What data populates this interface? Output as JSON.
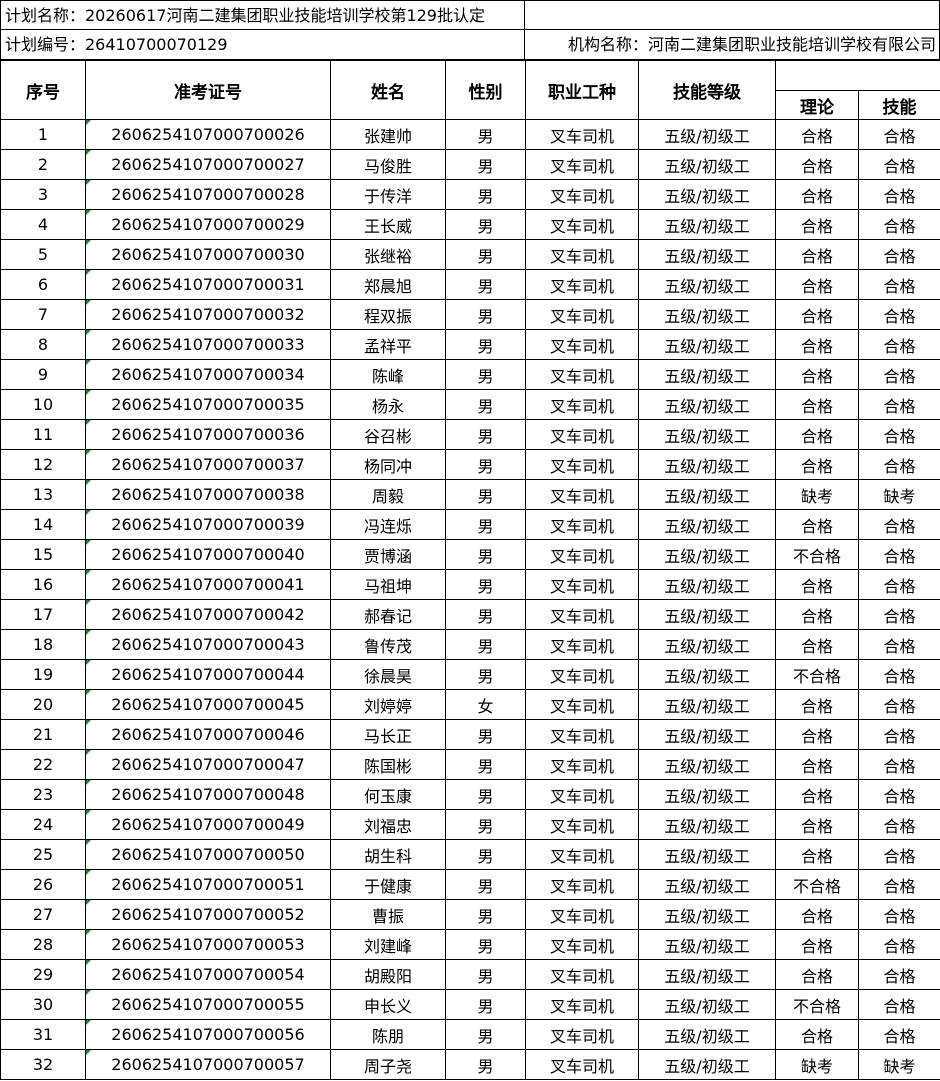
{
  "header": {
    "plan_name": "计划名称：20260617河南二建集团职业技能培训学校第129批认定",
    "plan_number": "计划编号：26410700070129",
    "org_name": "机构名称：河南二建集团职业技能培训学校有限公司"
  },
  "columns": {
    "seq": "序号",
    "ticket": "准考证号",
    "name": "姓名",
    "gender": "性别",
    "job": "职业工种",
    "level": "技能等级",
    "theory": "理论",
    "skill": "技能"
  },
  "rows": [
    {
      "seq": "1",
      "ticket": "2606254107000700026",
      "name": "张建帅",
      "gender": "男",
      "job": "叉车司机",
      "level": "五级/初级工",
      "theory": "合格",
      "skill": "合格"
    },
    {
      "seq": "2",
      "ticket": "2606254107000700027",
      "name": "马俊胜",
      "gender": "男",
      "job": "叉车司机",
      "level": "五级/初级工",
      "theory": "合格",
      "skill": "合格"
    },
    {
      "seq": "3",
      "ticket": "2606254107000700028",
      "name": "于传洋",
      "gender": "男",
      "job": "叉车司机",
      "level": "五级/初级工",
      "theory": "合格",
      "skill": "合格"
    },
    {
      "seq": "4",
      "ticket": "2606254107000700029",
      "name": "王长威",
      "gender": "男",
      "job": "叉车司机",
      "level": "五级/初级工",
      "theory": "合格",
      "skill": "合格"
    },
    {
      "seq": "5",
      "ticket": "2606254107000700030",
      "name": "张继裕",
      "gender": "男",
      "job": "叉车司机",
      "level": "五级/初级工",
      "theory": "合格",
      "skill": "合格"
    },
    {
      "seq": "6",
      "ticket": "2606254107000700031",
      "name": "郑晨旭",
      "gender": "男",
      "job": "叉车司机",
      "level": "五级/初级工",
      "theory": "合格",
      "skill": "合格"
    },
    {
      "seq": "7",
      "ticket": "2606254107000700032",
      "name": "程双振",
      "gender": "男",
      "job": "叉车司机",
      "level": "五级/初级工",
      "theory": "合格",
      "skill": "合格"
    },
    {
      "seq": "8",
      "ticket": "2606254107000700033",
      "name": "孟祥平",
      "gender": "男",
      "job": "叉车司机",
      "level": "五级/初级工",
      "theory": "合格",
      "skill": "合格"
    },
    {
      "seq": "9",
      "ticket": "2606254107000700034",
      "name": "陈峰",
      "gender": "男",
      "job": "叉车司机",
      "level": "五级/初级工",
      "theory": "合格",
      "skill": "合格"
    },
    {
      "seq": "10",
      "ticket": "2606254107000700035",
      "name": "杨永",
      "gender": "男",
      "job": "叉车司机",
      "level": "五级/初级工",
      "theory": "合格",
      "skill": "合格"
    },
    {
      "seq": "11",
      "ticket": "2606254107000700036",
      "name": "谷召彬",
      "gender": "男",
      "job": "叉车司机",
      "level": "五级/初级工",
      "theory": "合格",
      "skill": "合格"
    },
    {
      "seq": "12",
      "ticket": "2606254107000700037",
      "name": "杨同冲",
      "gender": "男",
      "job": "叉车司机",
      "level": "五级/初级工",
      "theory": "合格",
      "skill": "合格"
    },
    {
      "seq": "13",
      "ticket": "2606254107000700038",
      "name": "周毅",
      "gender": "男",
      "job": "叉车司机",
      "level": "五级/初级工",
      "theory": "缺考",
      "skill": "缺考"
    },
    {
      "seq": "14",
      "ticket": "2606254107000700039",
      "name": "冯连烁",
      "gender": "男",
      "job": "叉车司机",
      "level": "五级/初级工",
      "theory": "合格",
      "skill": "合格"
    },
    {
      "seq": "15",
      "ticket": "2606254107000700040",
      "name": "贾博涵",
      "gender": "男",
      "job": "叉车司机",
      "level": "五级/初级工",
      "theory": "不合格",
      "skill": "合格"
    },
    {
      "seq": "16",
      "ticket": "2606254107000700041",
      "name": "马祖坤",
      "gender": "男",
      "job": "叉车司机",
      "level": "五级/初级工",
      "theory": "合格",
      "skill": "合格"
    },
    {
      "seq": "17",
      "ticket": "2606254107000700042",
      "name": "郝春记",
      "gender": "男",
      "job": "叉车司机",
      "level": "五级/初级工",
      "theory": "合格",
      "skill": "合格"
    },
    {
      "seq": "18",
      "ticket": "2606254107000700043",
      "name": "鲁传茂",
      "gender": "男",
      "job": "叉车司机",
      "level": "五级/初级工",
      "theory": "合格",
      "skill": "合格"
    },
    {
      "seq": "19",
      "ticket": "2606254107000700044",
      "name": "徐晨昊",
      "gender": "男",
      "job": "叉车司机",
      "level": "五级/初级工",
      "theory": "不合格",
      "skill": "合格"
    },
    {
      "seq": "20",
      "ticket": "2606254107000700045",
      "name": "刘婷婷",
      "gender": "女",
      "job": "叉车司机",
      "level": "五级/初级工",
      "theory": "合格",
      "skill": "合格"
    },
    {
      "seq": "21",
      "ticket": "2606254107000700046",
      "name": "马长正",
      "gender": "男",
      "job": "叉车司机",
      "level": "五级/初级工",
      "theory": "合格",
      "skill": "合格"
    },
    {
      "seq": "22",
      "ticket": "2606254107000700047",
      "name": "陈国彬",
      "gender": "男",
      "job": "叉车司机",
      "level": "五级/初级工",
      "theory": "合格",
      "skill": "合格"
    },
    {
      "seq": "23",
      "ticket": "2606254107000700048",
      "name": "何玉康",
      "gender": "男",
      "job": "叉车司机",
      "level": "五级/初级工",
      "theory": "合格",
      "skill": "合格"
    },
    {
      "seq": "24",
      "ticket": "2606254107000700049",
      "name": "刘福忠",
      "gender": "男",
      "job": "叉车司机",
      "level": "五级/初级工",
      "theory": "合格",
      "skill": "合格"
    },
    {
      "seq": "25",
      "ticket": "2606254107000700050",
      "name": "胡生科",
      "gender": "男",
      "job": "叉车司机",
      "level": "五级/初级工",
      "theory": "合格",
      "skill": "合格"
    },
    {
      "seq": "26",
      "ticket": "2606254107000700051",
      "name": "于健康",
      "gender": "男",
      "job": "叉车司机",
      "level": "五级/初级工",
      "theory": "不合格",
      "skill": "合格"
    },
    {
      "seq": "27",
      "ticket": "2606254107000700052",
      "name": "曹振",
      "gender": "男",
      "job": "叉车司机",
      "level": "五级/初级工",
      "theory": "合格",
      "skill": "合格"
    },
    {
      "seq": "28",
      "ticket": "2606254107000700053",
      "name": "刘建峰",
      "gender": "男",
      "job": "叉车司机",
      "level": "五级/初级工",
      "theory": "合格",
      "skill": "合格"
    },
    {
      "seq": "29",
      "ticket": "2606254107000700054",
      "name": "胡殿阳",
      "gender": "男",
      "job": "叉车司机",
      "level": "五级/初级工",
      "theory": "合格",
      "skill": "合格"
    },
    {
      "seq": "30",
      "ticket": "2606254107000700055",
      "name": "申长义",
      "gender": "男",
      "job": "叉车司机",
      "level": "五级/初级工",
      "theory": "不合格",
      "skill": "合格"
    },
    {
      "seq": "31",
      "ticket": "2606254107000700056",
      "name": "陈朋",
      "gender": "男",
      "job": "叉车司机",
      "level": "五级/初级工",
      "theory": "合格",
      "skill": "合格"
    },
    {
      "seq": "32",
      "ticket": "2606254107000700057",
      "name": "周子尧",
      "gender": "男",
      "job": "叉车司机",
      "level": "五级/初级工",
      "theory": "缺考",
      "skill": "缺考"
    }
  ]
}
